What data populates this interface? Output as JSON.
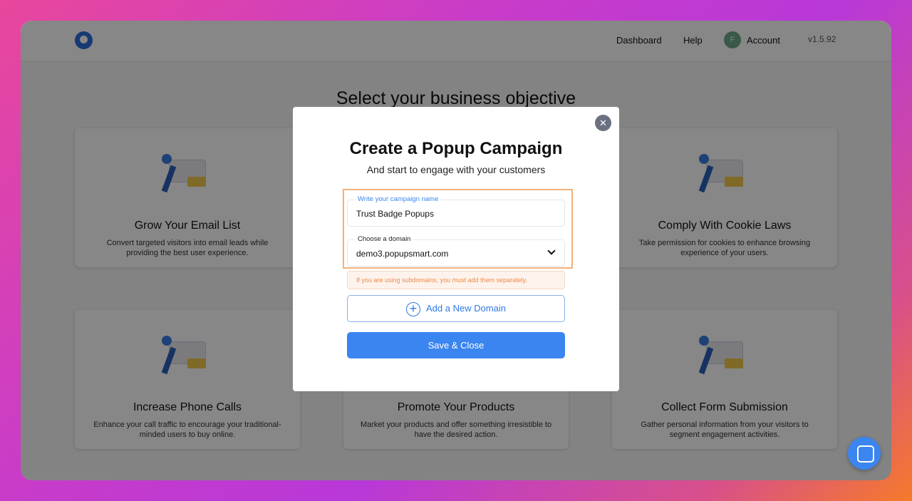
{
  "header": {
    "nav": [
      "Dashboard",
      "Help"
    ],
    "avatar_initial": "F",
    "account": "Account",
    "version": "v1.5.92"
  },
  "page_title": "Select your business objective",
  "cards": [
    {
      "title": "Grow Your Email List",
      "desc": "Convert targeted visitors into email leads while providing the best user experience."
    },
    {
      "title": "",
      "desc": ""
    },
    {
      "title": "Comply With Cookie Laws",
      "desc": "Take permission for cookies to enhance browsing experience of your users."
    },
    {
      "title": "Increase Phone Calls",
      "desc": "Enhance your call traffic to encourage your traditional-minded users to buy online."
    },
    {
      "title": "Promote Your Products",
      "desc": "Market your products and offer something irresistible to have the desired action."
    },
    {
      "title": "Collect Form Submission",
      "desc": "Gather personal information from your visitors to segment engagement activities."
    }
  ],
  "modal": {
    "close": "✕",
    "title": "Create a Popup Campaign",
    "subtitle": "And start to engage with your customers",
    "name_label": "Write your campaign name",
    "name_value": "Trust Badge Popups",
    "domain_label": "Choose a domain",
    "domain_value": "demo3.popupsmart.com",
    "warning": "If you are using subdomains, you must add them separately.",
    "add_domain": "Add a New Domain",
    "save": "Save & Close"
  },
  "colors": {
    "primary": "#3b85f0",
    "highlight": "#f3b17a",
    "warning": "#ec8a4a"
  }
}
